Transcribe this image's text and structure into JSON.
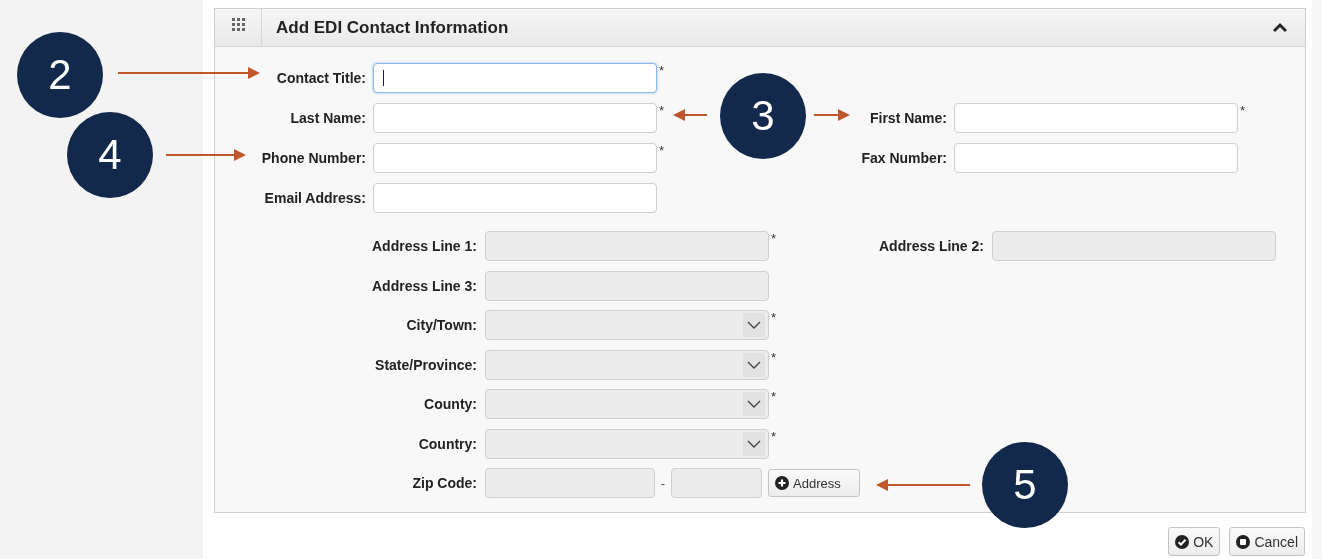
{
  "panel": {
    "title": "Add EDI Contact Information",
    "expanded": true,
    "required_mark": "*",
    "sections": [
      {
        "kind": "contact",
        "rows": [
          {
            "fields": [
              {
                "label": "Contact Title:",
                "kind": "text",
                "required": true,
                "disabled": false,
                "focused": true
              }
            ]
          },
          {
            "fields": [
              {
                "label": "Last Name:",
                "kind": "text",
                "required": true,
                "disabled": false,
                "focused": false
              },
              {
                "label": "First Name:",
                "kind": "text",
                "required": true,
                "disabled": false,
                "focused": false
              }
            ]
          },
          {
            "fields": [
              {
                "label": "Phone Number:",
                "kind": "text",
                "required": true,
                "disabled": false,
                "focused": false
              },
              {
                "label": "Fax Number:",
                "kind": "text",
                "required": false,
                "disabled": false,
                "focused": false
              }
            ]
          },
          {
            "fields": [
              {
                "label": "Email Address:",
                "kind": "text",
                "required": false,
                "disabled": false,
                "focused": false
              }
            ]
          }
        ]
      },
      {
        "kind": "address",
        "rows": [
          {
            "fields": [
              {
                "label": "Address Line 1:",
                "kind": "text",
                "required": true,
                "disabled": true,
                "focused": false
              },
              {
                "label": "Address Line 2:",
                "kind": "text",
                "required": false,
                "disabled": true,
                "focused": false
              }
            ]
          },
          {
            "fields": [
              {
                "label": "Address Line 3:",
                "kind": "text",
                "required": false,
                "disabled": true,
                "focused": false
              }
            ]
          },
          {
            "fields": [
              {
                "label": "City/Town:",
                "kind": "select",
                "required": true,
                "disabled": true,
                "focused": false
              }
            ]
          },
          {
            "fields": [
              {
                "label": "State/Province:",
                "kind": "select",
                "required": true,
                "disabled": true,
                "focused": false
              }
            ]
          },
          {
            "fields": [
              {
                "label": "County:",
                "kind": "select",
                "required": true,
                "disabled": true,
                "focused": false
              }
            ]
          },
          {
            "fields": [
              {
                "label": "Country:",
                "kind": "select",
                "required": true,
                "disabled": true,
                "focused": false
              }
            ]
          },
          {
            "fields": [
              {
                "label": "Zip Code:",
                "kind": "zip",
                "required": false,
                "disabled": true,
                "focused": false,
                "separator": "-",
                "button": "Address"
              }
            ]
          }
        ]
      }
    ]
  },
  "buttons": [
    {
      "label": "OK",
      "kind": "ok"
    },
    {
      "label": "Cancel",
      "kind": "cancel"
    }
  ],
  "annotations": [
    {
      "label": "2"
    },
    {
      "label": "3"
    },
    {
      "label": "4"
    },
    {
      "label": "5"
    }
  ]
}
